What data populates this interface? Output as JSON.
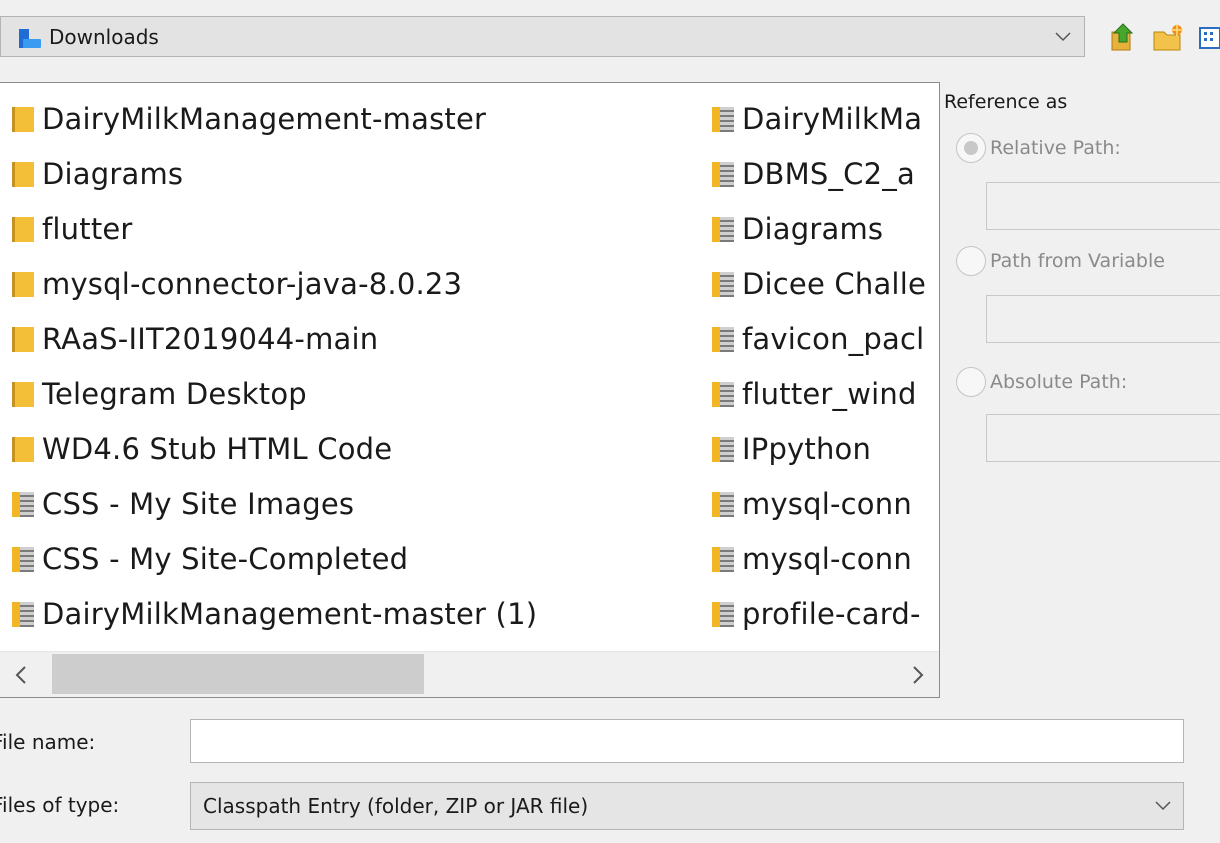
{
  "location": {
    "current_folder": "Downloads",
    "icon": "blue-folder-icon",
    "toolbar_icons": [
      "up-folder-icon",
      "new-folder-icon",
      "list-view-icon"
    ]
  },
  "files": {
    "column_1": [
      {
        "name": "DairyMilkManagement-master",
        "icon": "folder-icon"
      },
      {
        "name": "Diagrams",
        "icon": "folder-icon"
      },
      {
        "name": "flutter",
        "icon": "folder-icon"
      },
      {
        "name": "mysql-connector-java-8.0.23",
        "icon": "folder-icon"
      },
      {
        "name": "RAaS-IIT2019044-main",
        "icon": "folder-icon"
      },
      {
        "name": "Telegram Desktop",
        "icon": "folder-icon"
      },
      {
        "name": "WD4.6 Stub HTML Code",
        "icon": "folder-icon"
      },
      {
        "name": "CSS - My Site Images",
        "icon": "zip-folder-icon"
      },
      {
        "name": "CSS - My Site-Completed",
        "icon": "zip-folder-icon"
      },
      {
        "name": "DairyMilkManagement-master (1)",
        "icon": "zip-folder-icon"
      }
    ],
    "column_2": [
      {
        "name": "DairyMilkMa",
        "icon": "zip-folder-icon"
      },
      {
        "name": "DBMS_C2_a",
        "icon": "zip-folder-icon"
      },
      {
        "name": "Diagrams",
        "icon": "zip-folder-icon"
      },
      {
        "name": "Dicee Challe",
        "icon": "zip-folder-icon"
      },
      {
        "name": "favicon_pacl",
        "icon": "zip-folder-icon"
      },
      {
        "name": "flutter_wind",
        "icon": "zip-folder-icon"
      },
      {
        "name": "IPpython",
        "icon": "zip-folder-icon"
      },
      {
        "name": "mysql-conn",
        "icon": "zip-folder-icon"
      },
      {
        "name": "mysql-conn",
        "icon": "zip-folder-icon"
      },
      {
        "name": "profile-card-",
        "icon": "zip-folder-icon"
      }
    ]
  },
  "reference": {
    "title": "Reference as",
    "options": [
      {
        "label": "Relative Path:",
        "checked": true
      },
      {
        "label": "Path from Variable",
        "checked": false
      },
      {
        "label": "Absolute Path:",
        "checked": false
      }
    ]
  },
  "filename": {
    "label": "File name:",
    "value": ""
  },
  "filetype": {
    "label": "Files of type:",
    "value": "Classpath Entry (folder, ZIP or JAR file)"
  },
  "colors": {
    "folder_yellow": "#f3bf38",
    "folder_blue": "#1f6cd6",
    "disabled_text": "#8a8a8a"
  }
}
